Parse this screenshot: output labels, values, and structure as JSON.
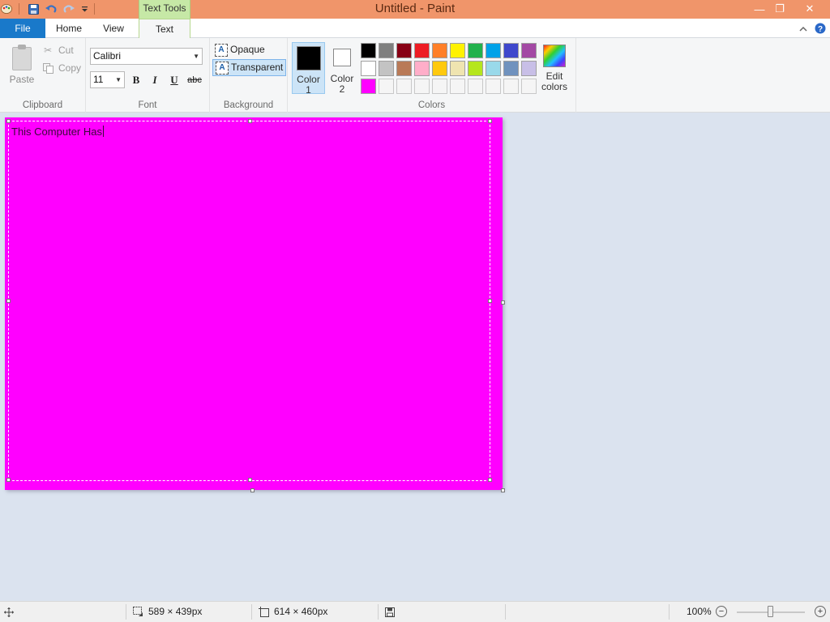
{
  "window": {
    "title": "Untitled - Paint",
    "context_tab_header": "Text Tools",
    "minimize_glyph": "—",
    "restore_glyph": "❐",
    "close_glyph": "✕"
  },
  "tabs": {
    "file": "File",
    "home": "Home",
    "view": "View",
    "text": "Text"
  },
  "ribbon": {
    "clipboard": {
      "label": "Clipboard",
      "paste": "Paste",
      "cut": "Cut",
      "copy": "Copy"
    },
    "font": {
      "label": "Font",
      "family": "Calibri",
      "size": "11",
      "bold": "B",
      "italic": "I",
      "underline": "U",
      "strikethrough": "abc"
    },
    "background": {
      "label": "Background",
      "opaque": "Opaque",
      "transparent": "Transparent",
      "selected": "Transparent"
    },
    "colors": {
      "label": "Colors",
      "color1_line1": "Color",
      "color1_line2": "1",
      "color2_line1": "Color",
      "color2_line2": "2",
      "color1_value": "#000000",
      "color2_value": "#ffffff",
      "edit_line1": "Edit",
      "edit_line2": "colors",
      "palette_row1": [
        "#000000",
        "#7f7f7f",
        "#880015",
        "#ed1c24",
        "#ff7f27",
        "#fff200",
        "#22b14c",
        "#00a2e8",
        "#3f48cc",
        "#a349a4"
      ],
      "palette_row2": [
        "#ffffff",
        "#c3c3c3",
        "#b97a57",
        "#ffaec9",
        "#ffc90e",
        "#efe4b0",
        "#b5e61d",
        "#99d9ea",
        "#7092be",
        "#c8bfe7"
      ],
      "palette_row3": [
        "#ff00ff",
        "#f5f5f5",
        "#f5f5f5",
        "#f5f5f5",
        "#f5f5f5",
        "#f5f5f5",
        "#f5f5f5",
        "#f5f5f5",
        "#f5f5f5",
        "#f5f5f5"
      ]
    }
  },
  "canvas": {
    "background_color": "#ff00ff",
    "typed_text": "This Computer Has"
  },
  "status": {
    "selection_size": "589 × 439px",
    "image_size": "614 × 460px",
    "zoom": "100%",
    "zoom_fraction": 0.5
  }
}
